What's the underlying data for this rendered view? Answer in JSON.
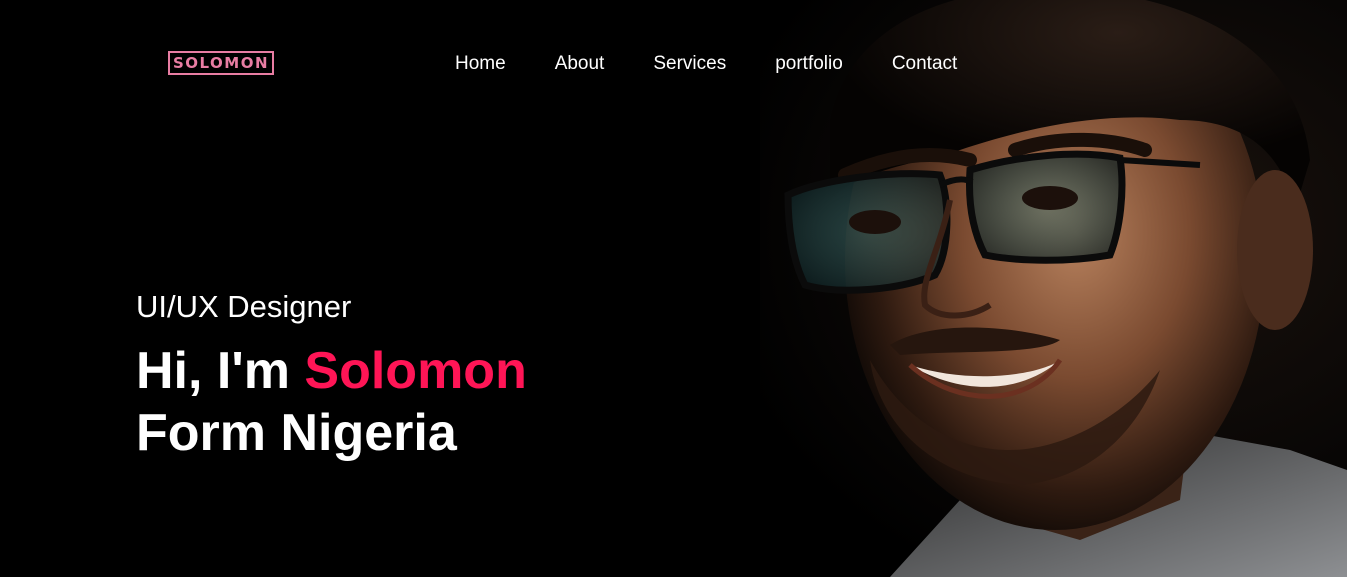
{
  "brand": {
    "logo_text": "SOLOMON"
  },
  "nav": {
    "items": [
      "Home",
      "About",
      "Services",
      "portfolio",
      "Contact"
    ]
  },
  "hero": {
    "role": "UI/UX Designer",
    "greeting": "Hi, I'm",
    "name": "Solomon",
    "origin": "Form Nigeria"
  },
  "colors": {
    "background": "#000000",
    "accent": "#ff1556",
    "logo": "#e87da3",
    "text": "#ffffff"
  }
}
